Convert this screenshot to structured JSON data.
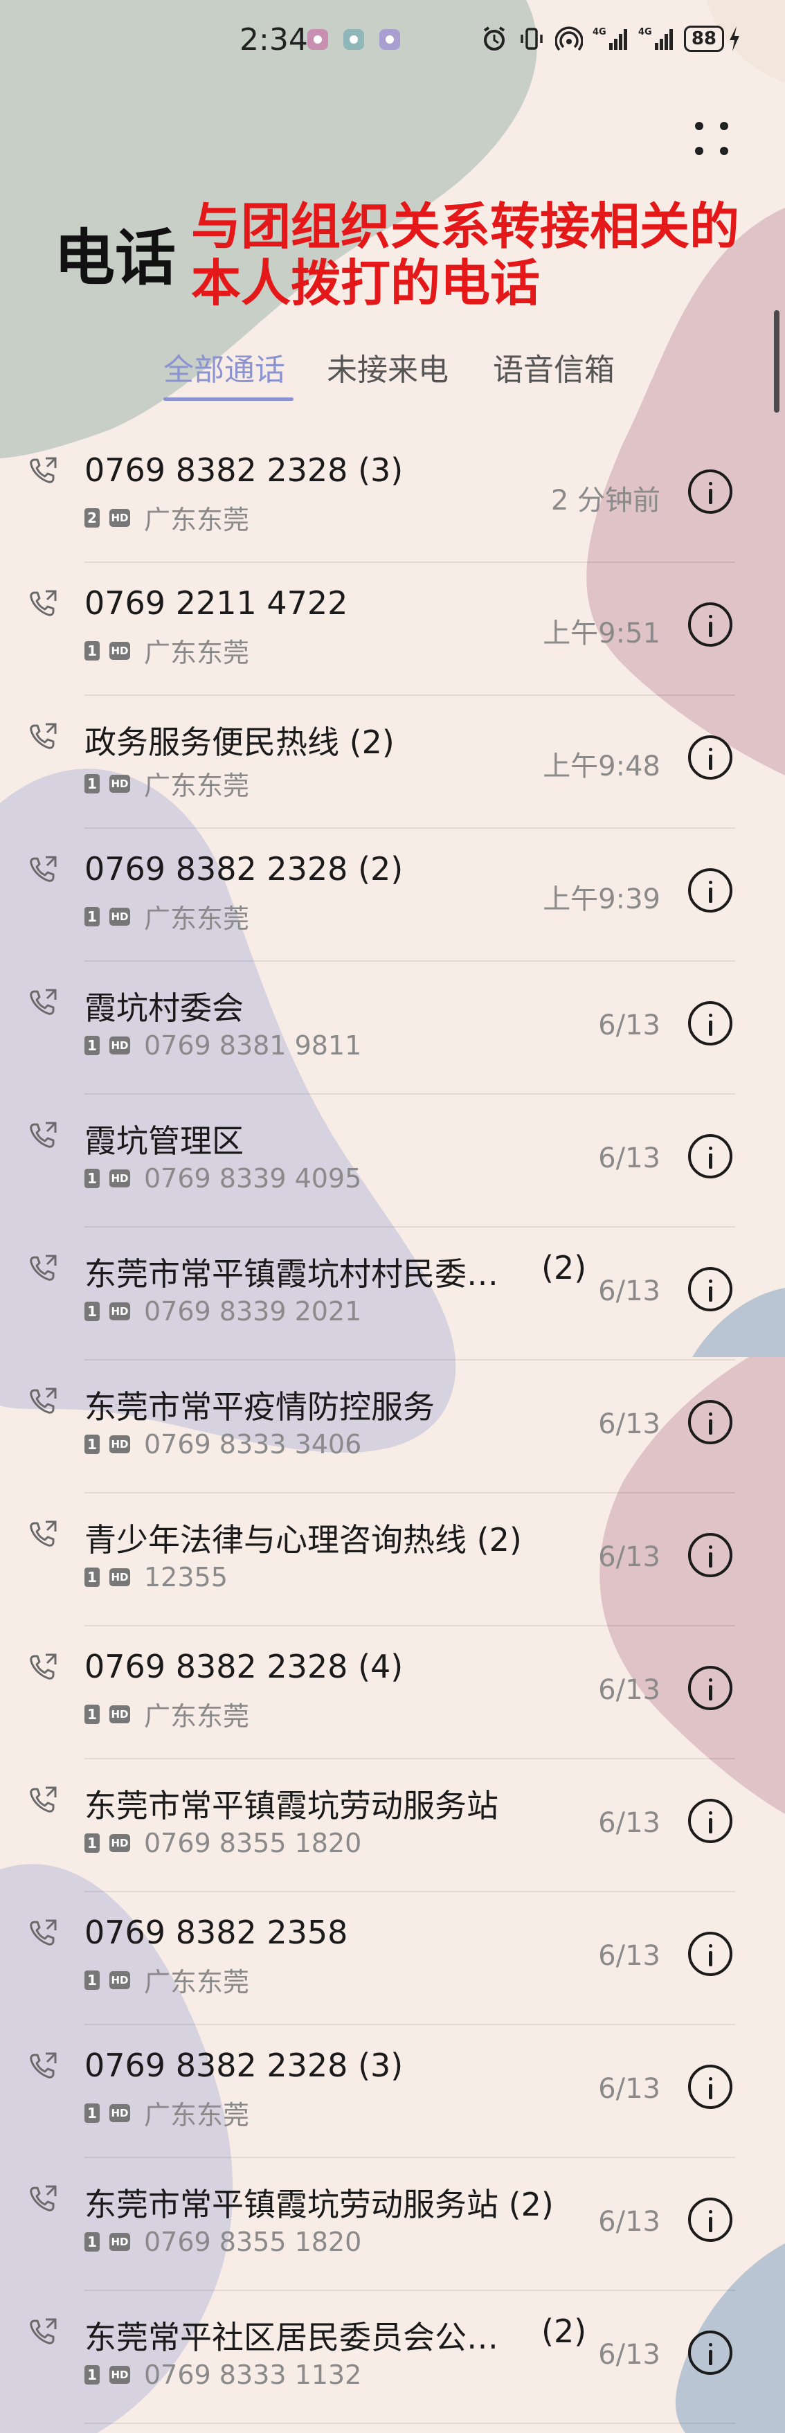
{
  "status_bar": {
    "time": "2:34",
    "battery": "88"
  },
  "header": {
    "title": "电话",
    "annotation_line1": "与团组织关系转接相关的",
    "annotation_line2": "本人拨打的电话"
  },
  "tabs": [
    {
      "label": "全部通话",
      "active": true
    },
    {
      "label": "未接来电",
      "active": false
    },
    {
      "label": "语音信箱",
      "active": false
    }
  ],
  "calls": [
    {
      "name": "0769 8382 2328 (3)",
      "count": "",
      "sim": "2",
      "detail": "广东东莞",
      "time": "2 分钟前"
    },
    {
      "name": "0769 2211 4722",
      "count": "",
      "sim": "1",
      "detail": "广东东莞",
      "time": "上午9:51"
    },
    {
      "name": "政务服务便民热线 (2)",
      "count": "",
      "sim": "1",
      "detail": "广东东莞",
      "time": "上午9:48"
    },
    {
      "name": "0769 8382 2328 (2)",
      "count": "",
      "sim": "1",
      "detail": "广东东莞",
      "time": "上午9:39"
    },
    {
      "name": "霞坑村委会",
      "count": "",
      "sim": "1",
      "detail": "0769 8381 9811",
      "time": "6/13"
    },
    {
      "name": "霞坑管理区",
      "count": "",
      "sim": "1",
      "detail": "0769 8339 4095",
      "time": "6/13"
    },
    {
      "name": "东莞市常平镇霞坑村村民委…",
      "count": "(2)",
      "sim": "1",
      "detail": "0769 8339 2021",
      "time": "6/13"
    },
    {
      "name": "东莞市常平疫情防控服务",
      "count": "",
      "sim": "1",
      "detail": "0769 8333 3406",
      "time": "6/13"
    },
    {
      "name": "青少年法律与心理咨询热线 (2)",
      "count": "",
      "sim": "1",
      "detail": "12355",
      "time": "6/13"
    },
    {
      "name": "0769 8382 2328 (4)",
      "count": "",
      "sim": "1",
      "detail": "广东东莞",
      "time": "6/13"
    },
    {
      "name": "东莞市常平镇霞坑劳动服务站",
      "count": "",
      "sim": "1",
      "detail": "0769 8355 1820",
      "time": "6/13"
    },
    {
      "name": "0769 8382 2358",
      "count": "",
      "sim": "1",
      "detail": "广东东莞",
      "time": "6/13"
    },
    {
      "name": "0769 8382 2328 (3)",
      "count": "",
      "sim": "1",
      "detail": "广东东莞",
      "time": "6/13"
    },
    {
      "name": "东莞市常平镇霞坑劳动服务站 (2)",
      "count": "",
      "sim": "1",
      "detail": "0769 8355 1820",
      "time": "6/13"
    },
    {
      "name": "东莞常平社区居民委员会公…",
      "count": "(2)",
      "sim": "1",
      "detail": "0769 8333 1132",
      "time": "6/13"
    }
  ]
}
